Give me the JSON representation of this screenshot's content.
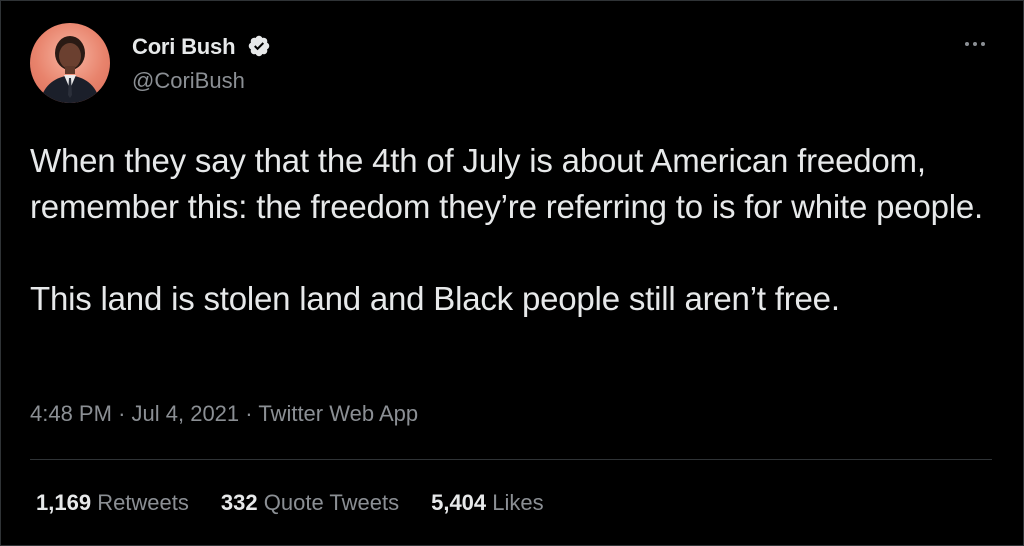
{
  "author": {
    "display_name": "Cori Bush",
    "handle": "@CoriBush",
    "verified": true,
    "avatar_bg": "#e8836c"
  },
  "icons": {
    "verified": "verified-badge-icon",
    "more": "more-horizontal-icon"
  },
  "tweet": {
    "paragraph_1": "When they say that the 4th of July is about American freedom, remember this: the freedom they’re referring to is for white people.",
    "paragraph_2": "This land is stolen land and Black people still aren’t free."
  },
  "meta": {
    "time": "4:48 PM",
    "separator": "·",
    "date": "Jul 4, 2021",
    "source": "Twitter Web App"
  },
  "stats": {
    "retweets_count": "1,169",
    "retweets_label": "Retweets",
    "quote_count": "332",
    "quote_label": "Quote Tweets",
    "likes_count": "5,404",
    "likes_label": "Likes"
  },
  "colors": {
    "background": "#000000",
    "primary_text": "#e7e9ea",
    "secondary_text": "#8b8f94",
    "divider": "#2f3336"
  }
}
